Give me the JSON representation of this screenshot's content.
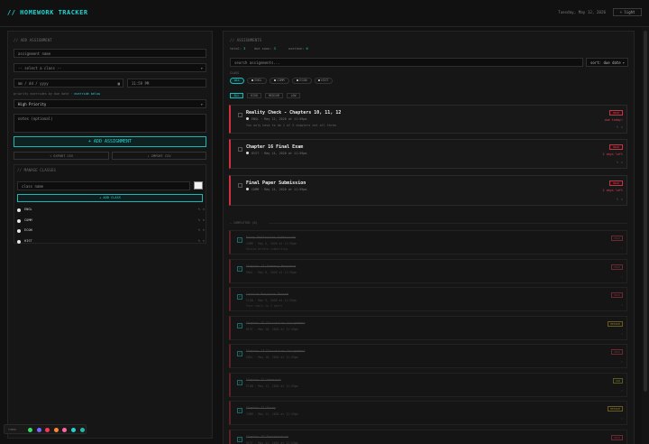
{
  "header": {
    "title": "// HOMEWORK TRACKER",
    "date": "Tuesday, May 12, 2026",
    "theme_label": "☼ light"
  },
  "add_panel": {
    "heading": "// ADD ASSIGNMENT",
    "name_placeholder": "assignment name",
    "class_select": "-- select a class --",
    "date_value": "mm / dd / yyyy",
    "time_value": "11:59 PM",
    "hint_prefix": "priority overrides by due date ·",
    "hint_link": "override below",
    "priority": "High Priority",
    "notes_placeholder": "notes (optional)",
    "add_button": "+ ADD ASSIGNMENT",
    "export_button": "↑ EXPORT CSV",
    "import_button": "↓ IMPORT CSV"
  },
  "classes": {
    "heading": "// MANAGE CLASSES",
    "name_placeholder": "class name",
    "add_button": "+ ADD CLASS",
    "items": [
      {
        "name": "ENGL"
      },
      {
        "name": "COMM"
      },
      {
        "name": "ECON"
      },
      {
        "name": "HIST"
      }
    ]
  },
  "palette": {
    "label": "THEME",
    "colors": [
      "#33dd66",
      "#7766ff",
      "#ff3355",
      "#ff8833",
      "#ff66aa",
      "#22d3d3",
      "#22bbaa"
    ]
  },
  "list": {
    "heading": "// ASSIGNMENTS",
    "stats": {
      "total_label": "total:",
      "total": "3",
      "due_label": "due soon:",
      "due": "3",
      "overdue_label": "overdue:",
      "overdue": "0"
    },
    "search_placeholder": "search assignments...",
    "sort": "sort: due date",
    "filter_label": "CLASS",
    "class_filters": [
      "ALL",
      "ENGL",
      "COMM",
      "ECON",
      "HIST"
    ],
    "priority_filters": [
      "ALL",
      "HIGH",
      "MEDIUM",
      "LOW"
    ]
  },
  "assignments": [
    {
      "title": "Reality Check - Chapters 10, 11, 12",
      "meta": "ENGL · May 12, 2026 at 11:59pm",
      "note": "You only have to do 1 of 3 chapters not all three",
      "priority": "HIGH",
      "due": "due today!"
    },
    {
      "title": "Chapter 16 Final Exam",
      "meta": "HIST · May 14, 2026 at 11:59pm",
      "note": "",
      "priority": "HIGH",
      "due": "2 days left"
    },
    {
      "title": "Final Paper Submission",
      "meta": "COMM · May 14, 2026 at 11:59pm",
      "note": "",
      "priority": "HIGH",
      "due": "2 days left"
    }
  ],
  "completed": {
    "heading": "— COMPLETED (8)",
    "items": [
      {
        "title": "Essay Reflection Submission",
        "meta": "COMM · May 6, 2026 at 11:59pm",
        "note": "Review before submitting",
        "priority": "HIGH"
      },
      {
        "title": "Chapter 14 Summary Response",
        "meta": "ENGL · May 8, 2026 at 11:59pm",
        "note": "",
        "priority": "HIGH"
      },
      {
        "title": "Lecture Response Posted",
        "meta": "ECON · May 9, 2026 at 11:59pm",
        "note": "Post reply to 2 peers",
        "priority": "HIGH"
      },
      {
        "title": "Chapter 15 Discussion Assignment",
        "meta": "HIST · May 10, 2026 at 11:59pm",
        "note": "",
        "priority": "MEDIUM"
      },
      {
        "title": "Chapter 13 Discussion Assignment",
        "meta": "ENGL · May 10, 2026 at 11:59pm",
        "note": "",
        "priority": "HIGH"
      },
      {
        "title": "Chapter 12 Homework",
        "meta": "ECON · May 11, 2026 at 11:59pm",
        "note": "",
        "priority": "LOW"
      },
      {
        "title": "Chapter 11 Essay",
        "meta": "COMM · May 11, 2026 at 11:59pm",
        "note": "",
        "priority": "MEDIUM"
      },
      {
        "title": "Chapter 10 Presentation",
        "meta": "HIST · May 11, 2026 at 11:59pm",
        "note": "",
        "priority": "HIGH"
      }
    ]
  }
}
